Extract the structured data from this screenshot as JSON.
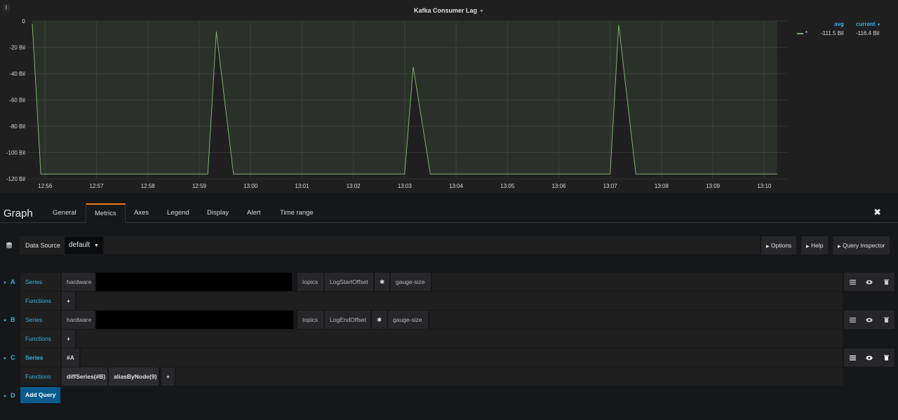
{
  "panel": {
    "info_icon": "i",
    "title": "Kafka Consumer Lag"
  },
  "legend": {
    "header_avg": "avg",
    "header_current": "current",
    "series_name": "*",
    "avg_value": "-111.5 Bil",
    "current_value": "-116.4 Bil",
    "series_color": "#7eb26d"
  },
  "chart_data": {
    "type": "line",
    "title": "Kafka Consumer Lag",
    "ylim": [
      -120,
      0
    ],
    "y_ticks": [
      0,
      -20,
      -40,
      -60,
      -80,
      -100,
      -120
    ],
    "y_tick_labels": [
      "0",
      "-20 Bil",
      "-40 Bil",
      "-60 Bil",
      "-80 Bil",
      "-100 Bil",
      "-120 Bil"
    ],
    "x_tick_labels": [
      "12:56",
      "12:57",
      "12:58",
      "12:59",
      "13:00",
      "13:01",
      "13:02",
      "13:03",
      "13:04",
      "13:05",
      "13:06",
      "13:07",
      "13:08",
      "13:09",
      "13:10"
    ],
    "grid": true,
    "legend_position": "right",
    "series": [
      {
        "name": "*",
        "color": "#7eb26d",
        "points": [
          [
            "12:55:45",
            -2
          ],
          [
            "12:55:55",
            -116.4
          ],
          [
            "12:59:10",
            -116.4
          ],
          [
            "12:59:20",
            -8
          ],
          [
            "12:59:40",
            -116.4
          ],
          [
            "13:03:00",
            -116.4
          ],
          [
            "13:03:10",
            -35
          ],
          [
            "13:03:30",
            -116.4
          ],
          [
            "13:07:00",
            -116.4
          ],
          [
            "13:07:10",
            -3
          ],
          [
            "13:07:30",
            -116.4
          ],
          [
            "13:10:15",
            -116.4
          ]
        ]
      }
    ]
  },
  "editor": {
    "title": "Graph",
    "tabs": [
      "General",
      "Metrics",
      "Axes",
      "Legend",
      "Display",
      "Alert",
      "Time range"
    ],
    "active_tab": "Metrics",
    "close_icon": "✖"
  },
  "datasource": {
    "label": "Data Source",
    "value": "default",
    "options_button": "Options",
    "help_button": "Help",
    "inspector_button": "Query Inspector"
  },
  "queries": {
    "a": {
      "letter": "A",
      "series_label": "Series",
      "functions_label": "Functions",
      "seg1": "hardware",
      "seg2": "topics",
      "seg3": "LogStartOffset",
      "seg4": "✱",
      "seg5": "gauge-size"
    },
    "b": {
      "letter": "B",
      "series_label": "Series",
      "functions_label": "Functions",
      "seg1": "hardware",
      "seg2": "topics",
      "seg3": "LogEndOffset",
      "seg4": "✱",
      "seg5": "gauge-size"
    },
    "c": {
      "letter": "C",
      "series_label": "Series",
      "functions_label": "Functions",
      "seg1": "#A",
      "fn1": "diffSeries(#B)",
      "fn2": "aliasByNode(9)"
    },
    "d": {
      "letter": "D",
      "add_label": "Add Query"
    },
    "plus": "+"
  }
}
